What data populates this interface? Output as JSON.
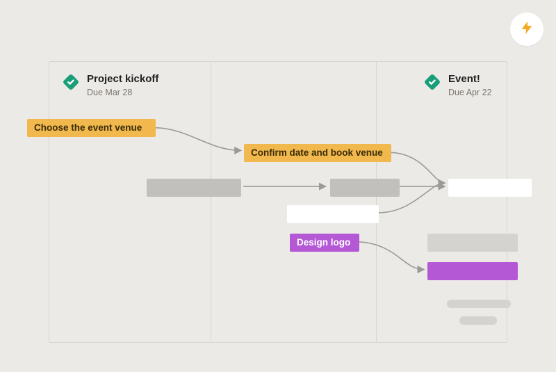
{
  "milestones": {
    "kickoff": {
      "title": "Project kickoff",
      "due": "Due Mar 28"
    },
    "event": {
      "title": "Event!",
      "due": "Due Apr 22"
    }
  },
  "tasks": {
    "choose_venue": {
      "label": "Choose the event venue"
    },
    "confirm_book": {
      "label": "Confirm date and book venue"
    },
    "design_logo": {
      "label": "Design logo"
    }
  },
  "colors": {
    "amber": "#f1b84d",
    "purple": "#b458d6",
    "gray": "#c2c0bc",
    "milestone_green": "#1a9e77",
    "bolt": "#f6a723"
  }
}
